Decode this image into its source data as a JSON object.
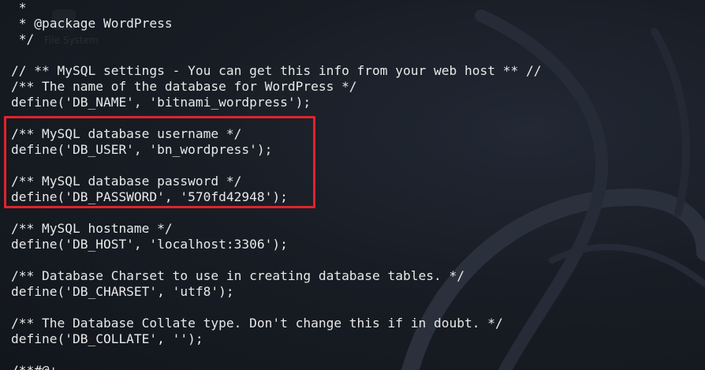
{
  "terminal": {
    "lines": [
      " *",
      " * @package WordPress",
      " */",
      "",
      "// ** MySQL settings - You can get this info from your web host ** //",
      "/** The name of the database for WordPress */",
      "define('DB_NAME', 'bitnami_wordpress');",
      "",
      "/** MySQL database username */",
      "define('DB_USER', 'bn_wordpress');",
      "",
      "/** MySQL database password */",
      "define('DB_PASSWORD', '570fd42948');",
      "",
      "/** MySQL hostname */",
      "define('DB_HOST', 'localhost:3306');",
      "",
      "/** Database Charset to use in creating database tables. */",
      "define('DB_CHARSET', 'utf8');",
      "",
      "/** The Database Collate type. Don't change this if in doubt. */",
      "define('DB_COLLATE', '');",
      "",
      "/**#@+"
    ]
  },
  "highlight": {
    "color": "#e0232c"
  },
  "background": {
    "desktop_icon_label": "File System"
  },
  "colors": {
    "text": "#e8e8e8",
    "background": "#181d25"
  }
}
